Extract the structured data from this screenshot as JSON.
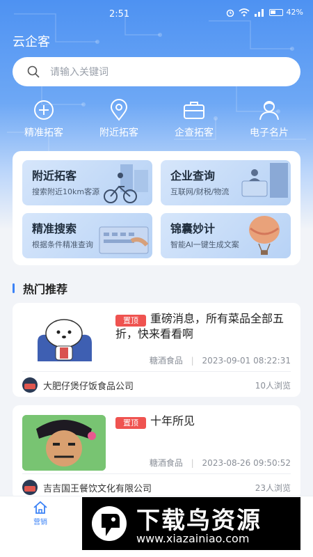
{
  "status_bar": {
    "time": "2:51",
    "signal": "↗",
    "battery": "42%"
  },
  "app": {
    "title": "云企客"
  },
  "search": {
    "placeholder": "请输入关键词"
  },
  "quick_nav": [
    {
      "label": "精准拓客",
      "icon": "target-plus-icon"
    },
    {
      "label": "附近拓客",
      "icon": "location-pin-icon"
    },
    {
      "label": "企查拓客",
      "icon": "briefcase-icon"
    },
    {
      "label": "电子名片",
      "icon": "person-card-icon"
    }
  ],
  "features": [
    {
      "title": "附近拓客",
      "subtitle": "搜索附近10km客源"
    },
    {
      "title": "企业查询",
      "subtitle": "互联网/财税/物流"
    },
    {
      "title": "精准搜索",
      "subtitle": "根据条件精准查询"
    },
    {
      "title": "锦囊妙计",
      "subtitle": "智能AI一键生成文案"
    }
  ],
  "section": {
    "title": "热门推荐"
  },
  "posts": [
    {
      "badge": "置顶",
      "title": "重磅消息，所有菜品全部五折，快来看看啊",
      "category": "糖酒食品",
      "date": "2023-09-01 08:22:31",
      "company": "大肥仔煲仔饭食品公司",
      "views": "10人浏览"
    },
    {
      "badge": "置顶",
      "title": "十年所见",
      "category": "糖酒食品",
      "date": "2023-08-26 09:50:52",
      "company": "吉吉国王餐饮文化有限公司",
      "views": "23人浏览"
    }
  ],
  "bottom_nav": {
    "home_label": "营销"
  },
  "watermark": {
    "text": "下载鸟资源",
    "url": "www.xiazainiao.com"
  },
  "colors": {
    "accent": "#3b82f6",
    "badge": "#ef5350",
    "hero_top": "#4e92f2"
  }
}
